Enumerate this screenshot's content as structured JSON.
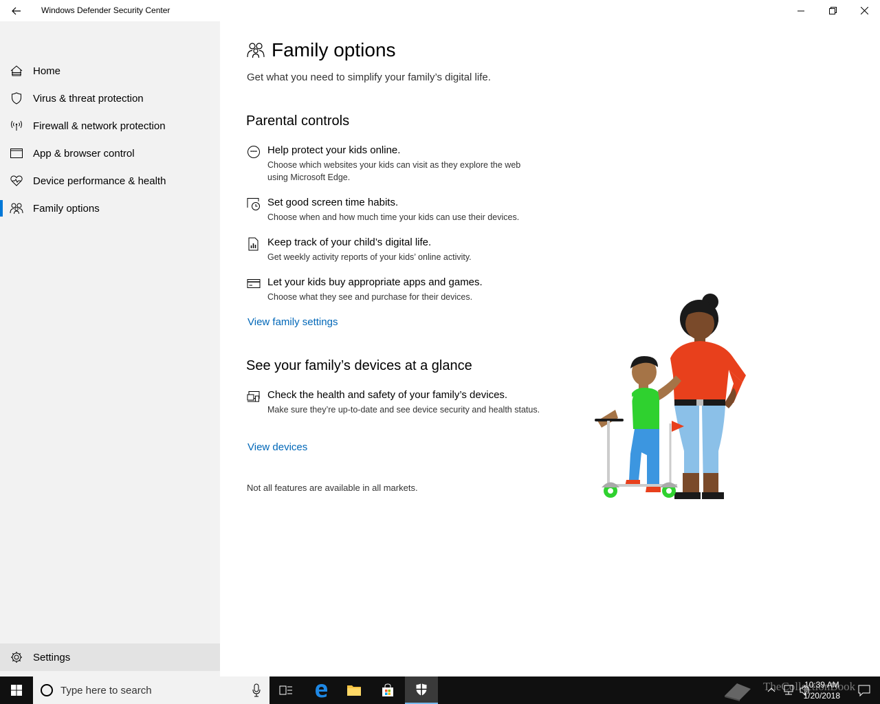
{
  "window": {
    "title": "Windows Defender Security Center"
  },
  "sidebar": {
    "items": [
      {
        "label": "Home",
        "icon": "home-icon"
      },
      {
        "label": "Virus & threat protection",
        "icon": "shield-icon"
      },
      {
        "label": "Firewall & network protection",
        "icon": "wireless-icon"
      },
      {
        "label": "App & browser control",
        "icon": "app-window-icon"
      },
      {
        "label": "Device performance & health",
        "icon": "heart-icon"
      },
      {
        "label": "Family options",
        "icon": "family-icon",
        "active": true
      }
    ],
    "settings_label": "Settings"
  },
  "main": {
    "title": "Family options",
    "subtitle": "Get what you need to simplify your family’s digital life.",
    "parental": {
      "title": "Parental controls",
      "features": [
        {
          "title": "Help protect your kids online.",
          "desc": "Choose which websites your kids can visit as they explore the web using Microsoft Edge.",
          "icon": "browse-icon"
        },
        {
          "title": "Set good screen time habits.",
          "desc": "Choose when and how much time your kids can use their devices.",
          "icon": "screen-clock-icon"
        },
        {
          "title": "Keep track of your child’s digital life.",
          "desc": "Get weekly activity reports of your kids’ online activity.",
          "icon": "report-icon"
        },
        {
          "title": "Let your kids buy appropriate apps and games.",
          "desc": "Choose what they see and purchase for their devices.",
          "icon": "credit-card-icon"
        }
      ],
      "link": "View family settings"
    },
    "devices": {
      "title": "See your family’s devices at a glance",
      "features": [
        {
          "title": "Check the health and safety of your family’s devices.",
          "desc": "Make sure they’re up-to-date and see device security and health status.",
          "icon": "devices-icon"
        }
      ],
      "link": "View devices"
    },
    "footnote": "Not all features are available in all markets."
  },
  "taskbar": {
    "search_placeholder": "Type here to search",
    "clock_time": "10:39 AM",
    "clock_date": "1/20/2018",
    "watermark": "TheCollectionBook",
    "accent": "#76b9ed"
  },
  "colors": {
    "accent": "#0078d7",
    "link": "#0067b8",
    "sidebar_bg": "#f2f2f2"
  }
}
